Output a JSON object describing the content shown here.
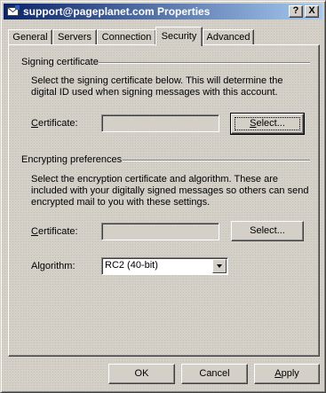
{
  "window": {
    "title": "support@pageplanet.com Properties",
    "help_button": "?",
    "close_button": "X"
  },
  "tabs": [
    {
      "label": "General",
      "active": false
    },
    {
      "label": "Servers",
      "active": false
    },
    {
      "label": "Connection",
      "active": false
    },
    {
      "label": "Security",
      "active": true
    },
    {
      "label": "Advanced",
      "active": false
    }
  ],
  "signing": {
    "title": "Signing certificate",
    "description": "Select the signing certificate below. This will determine the digital ID used when signing messages with this account.",
    "certificate_label_first": "C",
    "certificate_label_rest": "ertificate:",
    "certificate_value": "",
    "select_first": "S",
    "select_rest": "elect..."
  },
  "encrypting": {
    "title": "Encrypting preferences",
    "description": "Select the encryption certificate and algorithm. These are included with your digitally signed messages so others can send encrypted mail to you with these settings.",
    "certificate_label_first": "C",
    "certificate_label_rest": "ertificate:",
    "certificate_value": "",
    "select_label": "Select...",
    "algorithm_label": "Algorithm:",
    "algorithm_value": "RC2 (40-bit)"
  },
  "footer": {
    "ok": "OK",
    "cancel": "Cancel",
    "apply_first": "A",
    "apply_rest": "pply"
  }
}
